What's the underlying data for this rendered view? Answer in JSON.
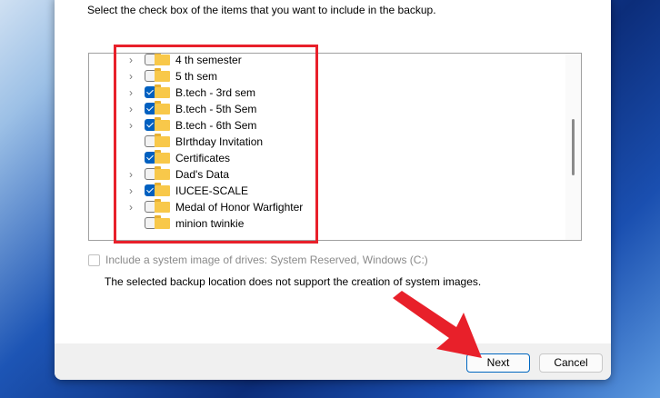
{
  "instruction": "Select the check box of the items that you want to include in the backup.",
  "items": [
    {
      "label": "4 th semester",
      "checked": false,
      "expandable": true
    },
    {
      "label": "5 th sem",
      "checked": false,
      "expandable": true
    },
    {
      "label": "B.tech - 3rd sem",
      "checked": true,
      "expandable": true
    },
    {
      "label": "B.tech - 5th Sem",
      "checked": true,
      "expandable": true
    },
    {
      "label": "B.tech - 6th Sem",
      "checked": true,
      "expandable": true
    },
    {
      "label": "BIrthday Invitation",
      "checked": false,
      "expandable": false
    },
    {
      "label": "Certificates",
      "checked": true,
      "expandable": false
    },
    {
      "label": "Dad's Data",
      "checked": false,
      "expandable": true
    },
    {
      "label": "IUCEE-SCALE",
      "checked": true,
      "expandable": true
    },
    {
      "label": "Medal of Honor Warfighter",
      "checked": false,
      "expandable": true
    },
    {
      "label": "minion twinkie",
      "checked": false,
      "expandable": false
    }
  ],
  "system_image_label": "Include a system image of drives: System Reserved, Windows (C:)",
  "note": "The selected backup location does not support the creation of system images.",
  "buttons": {
    "next": "Next",
    "cancel": "Cancel"
  },
  "colors": {
    "accent": "#0060c0",
    "highlight": "#e8202a"
  }
}
